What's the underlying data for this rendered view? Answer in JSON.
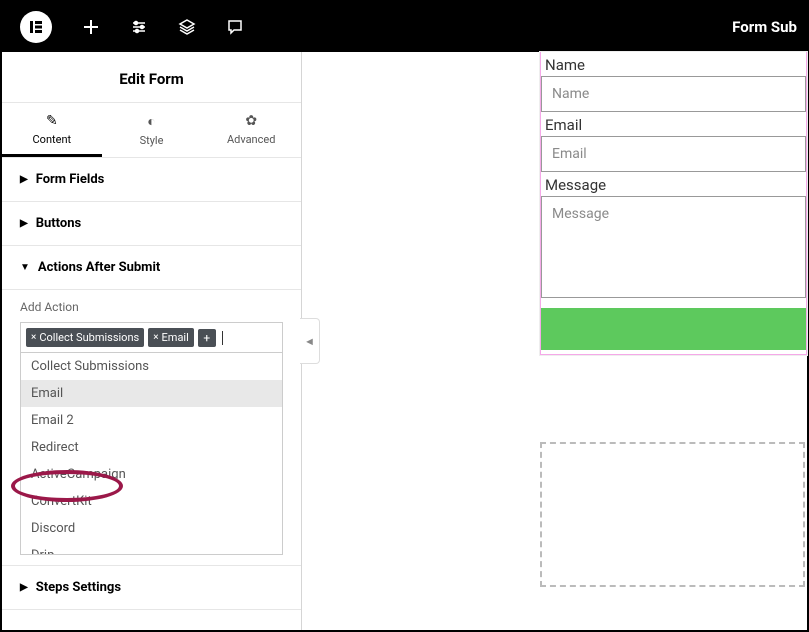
{
  "topbar": {
    "right_text": "Form Sub"
  },
  "panel": {
    "title": "Edit Form",
    "tabs": {
      "content": "Content",
      "style": "Style",
      "advanced": "Advanced"
    }
  },
  "sections": {
    "form_fields": "Form Fields",
    "buttons": "Buttons",
    "actions_after_submit": "Actions After Submit",
    "steps_settings": "Steps Settings"
  },
  "actions": {
    "add_label": "Add Action",
    "chips": {
      "collect": "Collect Submissions",
      "email": "Email"
    },
    "options": [
      "Collect Submissions",
      "Email",
      "Email 2",
      "Redirect",
      "ActiveCampaign",
      "ConvertKit",
      "Discord",
      "Drip"
    ]
  },
  "form": {
    "name_label": "Name",
    "name_placeholder": "Name",
    "email_label": "Email",
    "email_placeholder": "Email",
    "message_label": "Message",
    "message_placeholder": "Message"
  }
}
